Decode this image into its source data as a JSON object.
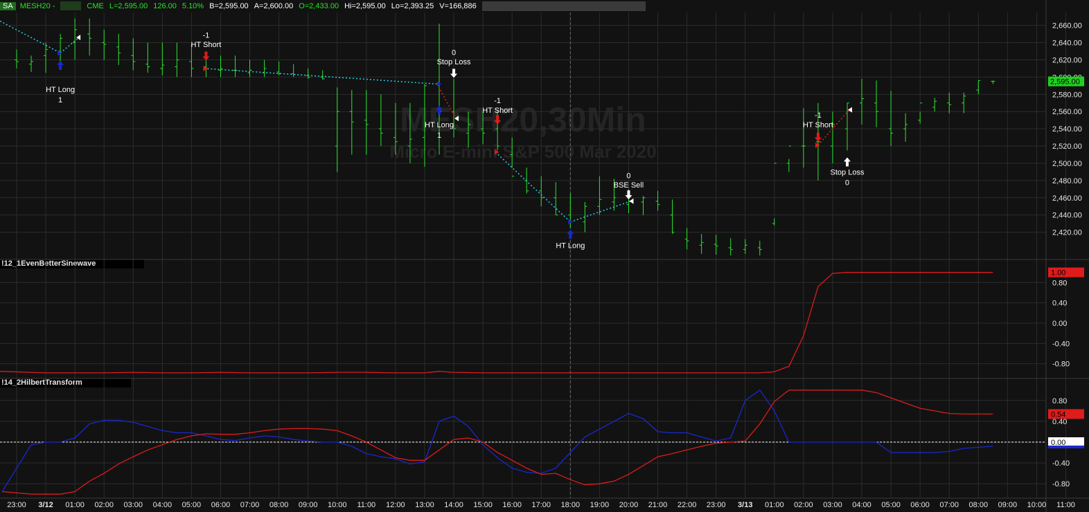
{
  "ticker": {
    "badge": "SA",
    "symbol": "MESH20 -",
    "exchange": "CME",
    "last": "L=2,595.00",
    "change": "126.00",
    "change_pct": "5.10%",
    "bid": "B=2,595.00",
    "ask": "A=2,600.00",
    "open": "O=2,433.00",
    "high": "Hi=2,595.00",
    "low": "Lo=2,393.25",
    "volume": "V=166,886"
  },
  "watermark": {
    "line1": "MESH20,30Min",
    "line2": "Micro E-mini S&P 500 Mar 2020"
  },
  "colors": {
    "bg": "#121212",
    "grid": "#2c2c2c",
    "bar": "#2ee62e",
    "cyan": "#22c8e0",
    "red": "#e01b1b",
    "blue": "#1a28d0",
    "white": "#ffffff"
  },
  "chart_data": [
    {
      "type": "ohlc",
      "name": "price",
      "x": [
        "23:00",
        "23:30",
        "3/12",
        "00:30",
        "01:00",
        "01:30",
        "02:00",
        "02:30",
        "03:00",
        "03:30",
        "04:00",
        "04:30",
        "05:00",
        "05:30",
        "06:00",
        "06:30",
        "07:00",
        "07:30",
        "08:00",
        "08:30",
        "09:00",
        "09:30",
        "10:00",
        "10:30",
        "11:00",
        "11:30",
        "12:00",
        "12:30",
        "13:00",
        "13:30",
        "14:00",
        "14:30",
        "15:00",
        "15:30",
        "16:00",
        "16:30",
        "17:00",
        "17:30",
        "18:00",
        "18:30",
        "19:00",
        "19:30",
        "20:00",
        "20:30",
        "21:00",
        "21:30",
        "22:00",
        "22:30",
        "23:00",
        "23:30",
        "3/13",
        "00:30",
        "01:00",
        "01:30",
        "02:00",
        "02:30",
        "03:00",
        "03:30",
        "04:00",
        "04:30",
        "05:00",
        "05:30",
        "06:00",
        "06:30",
        "07:00",
        "07:30",
        "08:00",
        "08:30"
      ],
      "high": [
        2632,
        2625,
        2640,
        2650,
        2668,
        2668,
        2655,
        2650,
        2645,
        2640,
        2640,
        2640,
        2638,
        2628,
        2625,
        2625,
        2620,
        2620,
        2618,
        2615,
        2610,
        2608,
        2588,
        2585,
        2585,
        2580,
        2570,
        2570,
        2592,
        2662,
        2598,
        2560,
        2560,
        2562,
        2530,
        2495,
        2485,
        2478,
        2465,
        2455,
        2485,
        2482,
        2470,
        2462,
        2468,
        2458,
        2425,
        2418,
        2417,
        2413,
        2412,
        2410,
        2436,
        2505,
        2564,
        2570,
        2560,
        2570,
        2598,
        2596,
        2584,
        2558,
        2560,
        2576,
        2582,
        2582,
        2596,
        2596
      ],
      "low": [
        2610,
        2606,
        2605,
        2615,
        2620,
        2625,
        2620,
        2614,
        2608,
        2605,
        2602,
        2600,
        2600,
        2600,
        2600,
        2600,
        2600,
        2600,
        2602,
        2600,
        2598,
        2597,
        2490,
        2510,
        2510,
        2520,
        2510,
        2500,
        2496,
        2510,
        2530,
        2518,
        2522,
        2515,
        2495,
        2465,
        2450,
        2440,
        2425,
        2420,
        2440,
        2445,
        2442,
        2440,
        2445,
        2418,
        2400,
        2395,
        2394,
        2393,
        2395,
        2393,
        2428,
        2490,
        2495,
        2480,
        2500,
        2515,
        2545,
        2542,
        2520,
        2525,
        2546,
        2560,
        2558,
        2558,
        2580,
        2592
      ],
      "open": [
        2620,
        2615,
        2625,
        2630,
        2640,
        2650,
        2640,
        2635,
        2625,
        2615,
        2610,
        2612,
        2618,
        2612,
        2608,
        2608,
        2605,
        2605,
        2606,
        2604,
        2602,
        2600,
        2520,
        2560,
        2550,
        2540,
        2530,
        2520,
        2530,
        2592,
        2560,
        2535,
        2540,
        2540,
        2510,
        2480,
        2468,
        2460,
        2440,
        2432,
        2450,
        2455,
        2452,
        2455,
        2456,
        2440,
        2412,
        2405,
        2406,
        2402,
        2400,
        2402,
        2430,
        2500,
        2520,
        2525,
        2520,
        2540,
        2570,
        2570,
        2540,
        2540,
        2550,
        2565,
        2570,
        2570,
        2585,
        2595
      ],
      "close": [
        2618,
        2618,
        2632,
        2645,
        2655,
        2645,
        2638,
        2628,
        2618,
        2612,
        2614,
        2620,
        2610,
        2610,
        2610,
        2608,
        2608,
        2610,
        2604,
        2603,
        2600,
        2598,
        2560,
        2548,
        2545,
        2535,
        2525,
        2528,
        2590,
        2560,
        2540,
        2545,
        2535,
        2520,
        2485,
        2468,
        2460,
        2440,
        2432,
        2450,
        2458,
        2460,
        2456,
        2460,
        2452,
        2420,
        2410,
        2408,
        2404,
        2400,
        2405,
        2400,
        2500,
        2520,
        2520,
        2525,
        2545,
        2570,
        2575,
        2560,
        2535,
        2545,
        2570,
        2572,
        2568,
        2578,
        2596,
        2595
      ]
    },
    {
      "type": "line",
      "name": "!12_1EvenBetterSinewave",
      "x": [
        "23:00",
        "00:00",
        "01:00",
        "02:00",
        "03:00",
        "04:00",
        "05:00",
        "06:00",
        "07:00",
        "08:00",
        "09:00",
        "10:00",
        "11:00",
        "12:00",
        "13:00",
        "13:30",
        "14:00",
        "15:00",
        "16:00",
        "17:00",
        "18:00",
        "19:00",
        "20:00",
        "21:00",
        "22:00",
        "23:00",
        "3/13",
        "00:30",
        "01:00",
        "01:30",
        "02:00",
        "02:30",
        "03:00",
        "03:30",
        "04:00",
        "05:00",
        "06:00",
        "07:00",
        "08:00",
        "08:30"
      ],
      "values": [
        -0.95,
        -0.98,
        -0.98,
        -0.98,
        -0.97,
        -0.98,
        -0.98,
        -0.97,
        -0.98,
        -0.98,
        -0.98,
        -0.97,
        -0.97,
        -0.98,
        -0.98,
        -0.95,
        -0.97,
        -0.98,
        -0.98,
        -0.98,
        -0.98,
        -0.98,
        -0.98,
        -0.98,
        -0.98,
        -0.98,
        -0.98,
        -0.98,
        -0.96,
        -0.85,
        -0.25,
        0.72,
        0.98,
        1.0,
        1.0,
        1.0,
        1.0,
        1.0,
        1.0,
        1.0
      ],
      "yticks": [
        "0.80",
        "0.40",
        "0.00",
        "-0.40",
        "-0.80"
      ],
      "last_label": "1.00",
      "ylim": [
        -1.05,
        1.05
      ]
    },
    {
      "type": "line",
      "name": "!14_2HilbertTransform",
      "x": [
        "23:00",
        "23:30",
        "3/12",
        "00:30",
        "01:00",
        "01:30",
        "02:00",
        "02:30",
        "03:00",
        "03:30",
        "04:00",
        "04:30",
        "05:00",
        "05:30",
        "06:00",
        "06:30",
        "07:00",
        "07:30",
        "08:00",
        "08:30",
        "09:00",
        "09:30",
        "10:00",
        "10:30",
        "11:00",
        "11:30",
        "12:00",
        "12:30",
        "13:00",
        "13:30",
        "14:00",
        "14:30",
        "15:00",
        "15:30",
        "16:00",
        "16:30",
        "17:00",
        "17:30",
        "18:00",
        "18:30",
        "19:00",
        "19:30",
        "20:00",
        "20:30",
        "21:00",
        "21:30",
        "22:00",
        "22:30",
        "23:00",
        "23:30",
        "3/13",
        "00:30",
        "01:00",
        "01:30",
        "02:00",
        "02:30",
        "03:00",
        "03:30",
        "04:00",
        "04:30",
        "05:00",
        "05:30",
        "06:00",
        "06:30",
        "07:00",
        "07:30",
        "08:00",
        "08:30"
      ],
      "series": [
        {
          "name": "blue",
          "values": [
            -0.95,
            -0.05,
            0,
            0,
            0.08,
            0.35,
            0.42,
            0.42,
            0.38,
            0.3,
            0.22,
            0.18,
            0.18,
            0.12,
            0.05,
            0.03,
            0.08,
            0.12,
            0.1,
            0.05,
            0.02,
            0,
            0,
            -0.08,
            -0.22,
            -0.28,
            -0.32,
            -0.42,
            -0.38,
            0.4,
            0.5,
            0.3,
            -0.05,
            -0.3,
            -0.5,
            -0.58,
            -0.6,
            -0.5,
            -0.2,
            0.1,
            0.25,
            0.4,
            0.55,
            0.45,
            0.2,
            0.18,
            0.18,
            0.1,
            0.02,
            0.08,
            0.8,
            1.0,
            0.6,
            0,
            0,
            0,
            0,
            0,
            0,
            0,
            -0.2,
            -0.2,
            -0.2,
            -0.2,
            -0.18,
            -0.12,
            -0.1,
            -0.08
          ]
        },
        {
          "name": "red",
          "values": [
            -0.95,
            -1.0,
            -1.0,
            -1.0,
            -0.95,
            -0.75,
            -0.6,
            -0.42,
            -0.28,
            -0.15,
            -0.05,
            0.05,
            0.12,
            0.16,
            0.15,
            0.15,
            0.18,
            0.22,
            0.25,
            0.26,
            0.26,
            0.25,
            0.22,
            0.12,
            0,
            -0.15,
            -0.3,
            -0.35,
            -0.35,
            -0.15,
            0.05,
            0.08,
            0,
            -0.2,
            -0.35,
            -0.5,
            -0.62,
            -0.6,
            -0.72,
            -0.82,
            -0.8,
            -0.75,
            -0.62,
            -0.45,
            -0.28,
            -0.22,
            -0.15,
            -0.08,
            -0.02,
            0,
            0.02,
            0.35,
            0.78,
            1.0,
            1.0,
            1.0,
            1.0,
            1.0,
            1.0,
            0.95,
            0.85,
            0.75,
            0.65,
            0.6,
            0.55,
            0.54,
            0.54,
            0.54
          ]
        }
      ],
      "yticks": [
        "0.80",
        "0.40",
        "0.00",
        "-0.40",
        "-0.80"
      ],
      "last_label_red": "0.54",
      "last_label_zero": "0.00",
      "ylim": [
        -1.05,
        1.05
      ]
    }
  ],
  "price_axis": {
    "ticks": [
      "2,660.00",
      "2,640.00",
      "2,620.00",
      "2,600.00",
      "2,580.00",
      "2,560.00",
      "2,540.00",
      "2,520.00",
      "2,500.00",
      "2,480.00",
      "2,460.00",
      "2,440.00",
      "2,420.00"
    ],
    "tick_values": [
      2660,
      2640,
      2620,
      2600,
      2580,
      2560,
      2540,
      2520,
      2500,
      2480,
      2460,
      2440,
      2420
    ],
    "last_label": "2,595.00",
    "ylim": [
      2390,
      2675
    ]
  },
  "time_axis": {
    "labels": [
      "23:00",
      "3/12",
      "01:00",
      "02:00",
      "03:00",
      "04:00",
      "05:00",
      "06:00",
      "07:00",
      "08:00",
      "09:00",
      "10:00",
      "11:00",
      "12:00",
      "13:00",
      "14:00",
      "15:00",
      "16:00",
      "17:00",
      "18:00",
      "19:00",
      "20:00",
      "21:00",
      "22:00",
      "23:00",
      "3/13",
      "01:00",
      "02:00",
      "03:00",
      "04:00",
      "05:00",
      "06:00",
      "07:00",
      "08:00",
      "09:00",
      "10:00",
      "11:00"
    ],
    "bold": [
      "3/12",
      "3/13"
    ]
  },
  "signals": [
    {
      "kind": "long",
      "label": "HT Long",
      "qty": "1",
      "at": "00:30"
    },
    {
      "kind": "short",
      "label": "HT Short",
      "qty": "-1",
      "at": "05:30"
    },
    {
      "kind": "stop",
      "label": "Stop Loss",
      "qty": "0",
      "at": "14:00"
    },
    {
      "kind": "long",
      "label": "HT Long",
      "qty": "1",
      "at": "13:30"
    },
    {
      "kind": "short",
      "label": "HT Short",
      "qty": "-1",
      "at": "15:30"
    },
    {
      "kind": "long",
      "label": "HT Long",
      "qty": "",
      "at": "18:00"
    },
    {
      "kind": "sell",
      "label": "BSE Sell",
      "qty": "0",
      "at": "20:00"
    },
    {
      "kind": "short",
      "label": "HT Short",
      "qty": "-1",
      "at": "02:30"
    },
    {
      "kind": "stop_up",
      "label": "Stop Loss",
      "qty": "0",
      "at": "03:30"
    }
  ]
}
